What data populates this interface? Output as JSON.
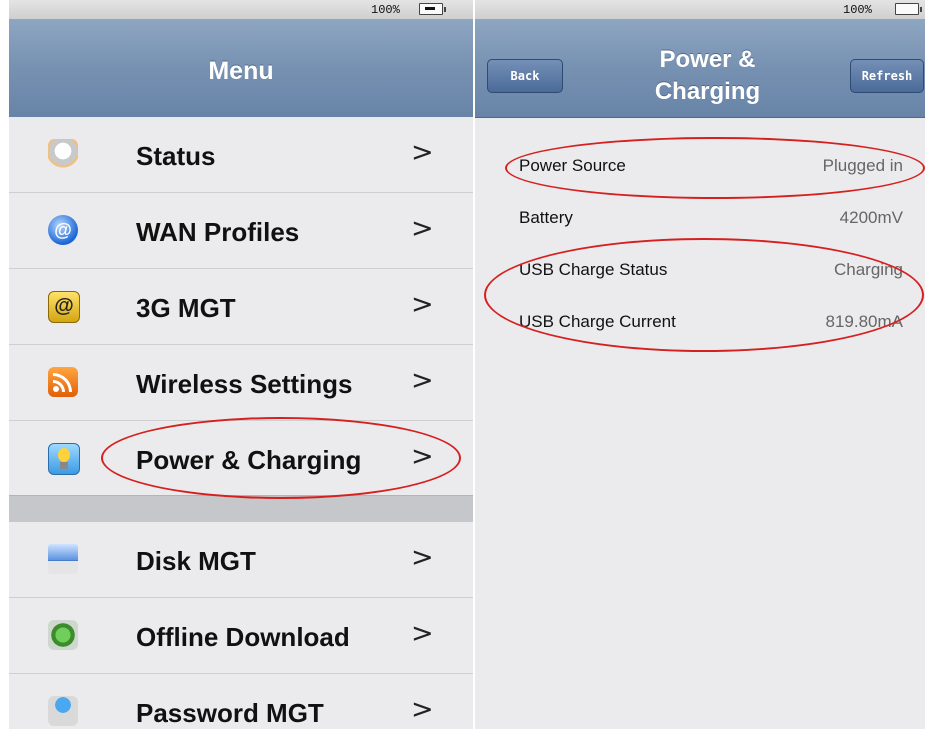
{
  "left_pane": {
    "status_bar": {
      "battery_percent": "100%"
    },
    "nav_title": "Menu",
    "menu_items": [
      {
        "label": "Status",
        "icon": "router-status-icon",
        "chevron": ">"
      },
      {
        "label": "WAN Profiles",
        "icon": "at-globe-icon",
        "chevron": ">"
      },
      {
        "label": "3G MGT",
        "icon": "at-sign-icon",
        "chevron": ">"
      },
      {
        "label": "Wireless Settings",
        "icon": "wireless-feed-icon",
        "chevron": ">"
      },
      {
        "label": "Power & Charging",
        "icon": "light-bulb-icon",
        "chevron": ">",
        "highlighted": true
      },
      {
        "label": "Disk MGT",
        "icon": "disk-icon",
        "chevron": ">"
      },
      {
        "label": "Offline Download",
        "icon": "cubes-download-icon",
        "chevron": ">"
      },
      {
        "label": "Password MGT",
        "icon": "padlock-icon",
        "chevron": ">"
      }
    ]
  },
  "right_pane": {
    "status_bar": {
      "battery_percent": "100%"
    },
    "nav_title_line1": "Power &",
    "nav_title_line2": "Charging",
    "back_label": "Back",
    "refresh_label": "Refresh",
    "rows": [
      {
        "key": "Power Source",
        "value": "Plugged in"
      },
      {
        "key": "Battery",
        "value": "4200mV"
      },
      {
        "key": "USB Charge Status",
        "value": "Charging"
      },
      {
        "key": "USB Charge Current",
        "value": "819.80mA"
      }
    ]
  },
  "annotation_color": "#d62020",
  "nav_color": "#7791b2"
}
